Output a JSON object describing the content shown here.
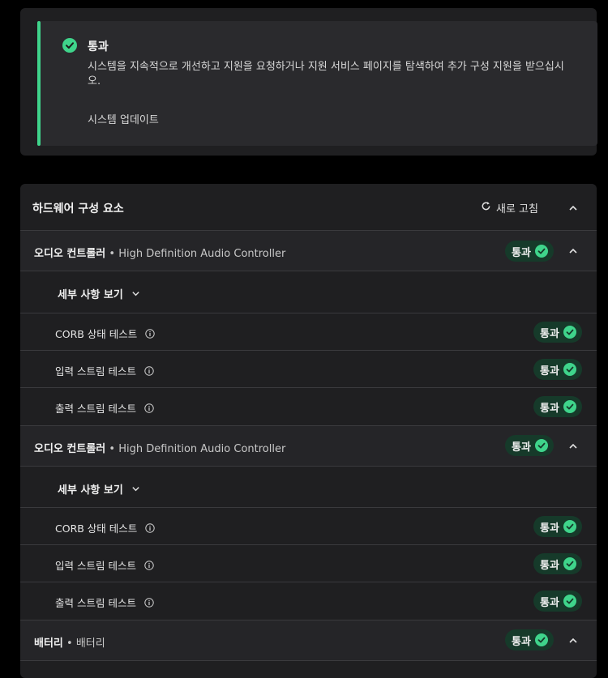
{
  "status": {
    "title": "통과",
    "description": "시스템을 지속적으로 개선하고 지원을 요청하거나 지원 서비스 페이지를 탐색하여 추가 구성 지원을 받으십시오.",
    "link": "시스템 업데이트",
    "accent_color": "#3fd48b"
  },
  "hardware": {
    "title": "하드웨어 구성 요소",
    "refresh_label": "새로 고침",
    "pass_label": "통과",
    "details_label": "세부 사항 보기",
    "components": [
      {
        "name": "오디오 컨트롤러",
        "separator": " • ",
        "device": "High Definition Audio Controller",
        "tests": [
          "CORB 상태 테스트",
          "입력 스트림 테스트",
          "출력 스트림 테스트"
        ]
      },
      {
        "name": "오디오 컨트롤러",
        "separator": " • ",
        "device": "High Definition Audio Controller",
        "tests": [
          "CORB 상태 테스트",
          "입력 스트림 테스트",
          "출력 스트림 테스트"
        ]
      },
      {
        "name": "배터리",
        "separator": " • ",
        "device": "배터리",
        "tests": []
      }
    ]
  }
}
